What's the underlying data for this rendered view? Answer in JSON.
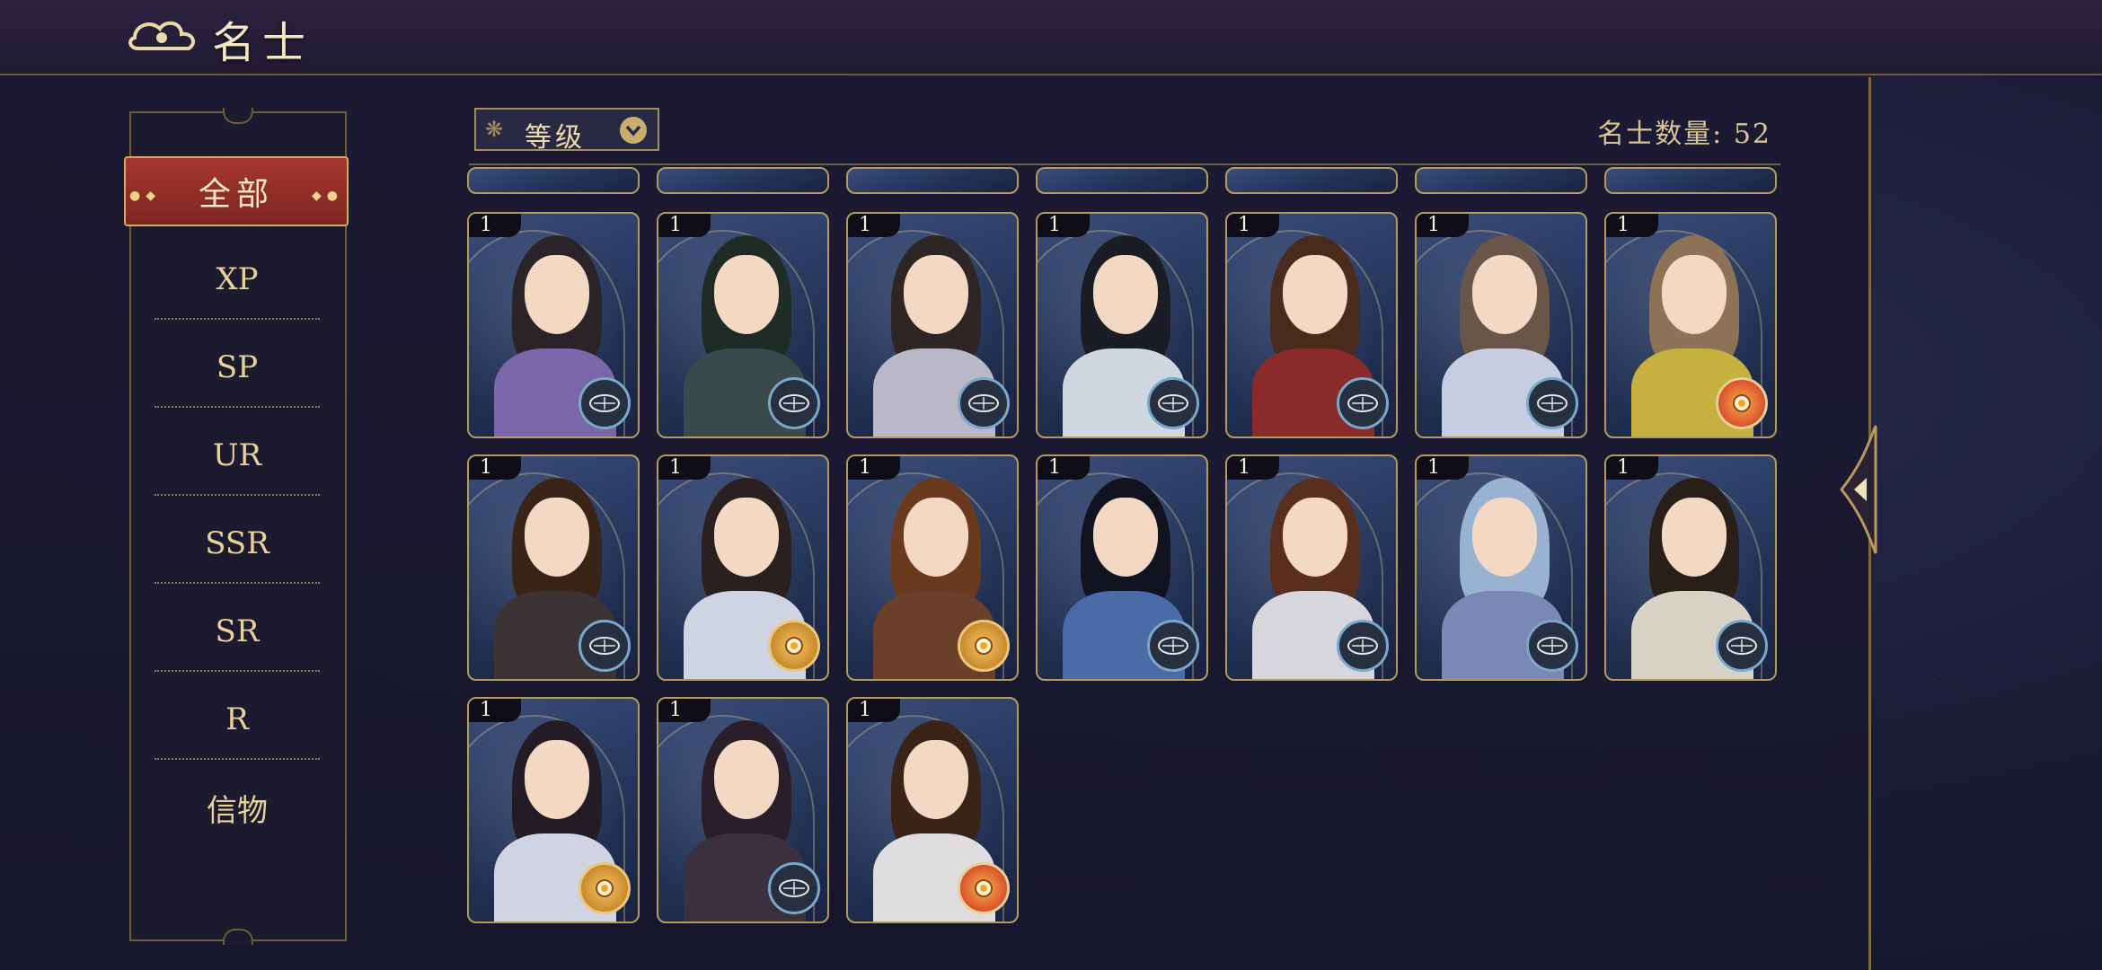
{
  "header": {
    "title": "名士"
  },
  "sidebar": {
    "active_tab": "全部",
    "tabs": [
      "XP",
      "SP",
      "UR",
      "SSR",
      "SR",
      "R",
      "信物"
    ]
  },
  "toolbar": {
    "sort_label": "等级",
    "count_label": "名士数量: 52"
  },
  "colors": {
    "accent_red": "#a5372f",
    "gold": "#c9ad6a",
    "badge_red": "#e6282e"
  },
  "cards": [
    {
      "level": "1",
      "emblem": "compass",
      "notif": true,
      "hair": "#2a2328",
      "body": "#7a66a8"
    },
    {
      "level": "1",
      "emblem": "compass",
      "notif": true,
      "hair": "#1f2b25",
      "body": "#3a4a4a"
    },
    {
      "level": "1",
      "emblem": "compass",
      "notif": true,
      "hair": "#2e2624",
      "body": "#b9b8c6"
    },
    {
      "level": "1",
      "emblem": "compass",
      "notif": true,
      "hair": "#1a1c26",
      "body": "#cfd7e0"
    },
    {
      "level": "1",
      "emblem": "compass",
      "notif": true,
      "hair": "#4b2a1e",
      "body": "#8a2a2a"
    },
    {
      "level": "1",
      "emblem": "compass",
      "notif": true,
      "hair": "#6a5648",
      "body": "#c7cde0"
    },
    {
      "level": "1",
      "emblem": "red",
      "notif": false,
      "hair": "#8e7256",
      "body": "#c6b03e"
    },
    {
      "level": "1",
      "emblem": "compass",
      "notif": true,
      "hair": "#3a2418",
      "body": "#3c3434"
    },
    {
      "level": "1",
      "emblem": "gold",
      "notif": true,
      "hair": "#2a2020",
      "body": "#cfd4e2"
    },
    {
      "level": "1",
      "emblem": "gold",
      "notif": false,
      "hair": "#6a3a1e",
      "body": "#6a4028"
    },
    {
      "level": "1",
      "emblem": "compass",
      "notif": true,
      "hair": "#111420",
      "body": "#4a6aa8"
    },
    {
      "level": "1",
      "emblem": "compass",
      "notif": true,
      "hair": "#5a2e1e",
      "body": "#d6d6dc"
    },
    {
      "level": "1",
      "emblem": "compass",
      "notif": true,
      "hair": "#9ab2d2",
      "body": "#7a88b6"
    },
    {
      "level": "1",
      "emblem": "compass",
      "notif": true,
      "hair": "#2a1e18",
      "body": "#d6d2c6"
    },
    {
      "level": "1",
      "emblem": "gold",
      "notif": false,
      "hair": "#241c24",
      "body": "#d0d4e2"
    },
    {
      "level": "1",
      "emblem": "compass",
      "notif": true,
      "hair": "#2a1e2a",
      "body": "#3a3040"
    },
    {
      "level": "1",
      "emblem": "red",
      "notif": false,
      "hair": "#3a2418",
      "body": "#e0dde0"
    }
  ]
}
